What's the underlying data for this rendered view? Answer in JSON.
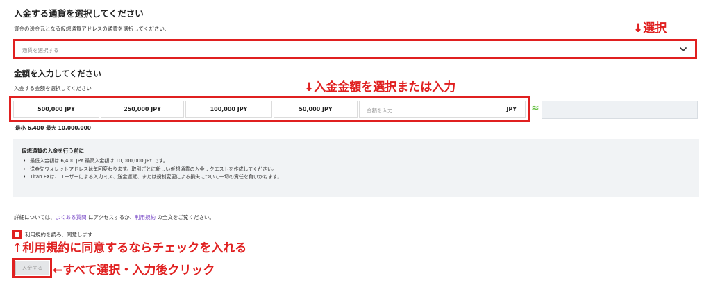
{
  "section1": {
    "title": "入金する通貨を選択してください",
    "subtitle": "資金の送金元となる仮想通貨アドレスの通貨を選択してください:",
    "select_placeholder": "通貨を選択する",
    "icon": "chevron-down-icon"
  },
  "section2": {
    "title": "金額を入力してください",
    "subtitle": "入金する金額を選択してください",
    "amounts": [
      "500,000 JPY",
      "250,000 JPY",
      "100,000 JPY",
      "50,000 JPY"
    ],
    "input_placeholder": "金額を入力",
    "input_currency": "JPY",
    "approx_symbol": "≈",
    "limits": "最小 6,400   最大 10,000,000"
  },
  "info": {
    "title": "仮想通貨の入金を行う前に",
    "items": [
      "最低入金額は 6,400 JPY   最高入金額は 10,000,000 JPY です。",
      "送金先ウォレットアドレスは毎回変わります。取引ごとに新しい仮想通貨の入金リクエストを作成してください。",
      "Titan FXは、ユーザーによる入力ミス、送金遅延、または規制変更による損失について一切の責任を負いかねます。"
    ]
  },
  "footer": {
    "prefix": "詳細については、",
    "faq_link": "よくある質問",
    "middle": " にアクセスするか、",
    "terms_link": "利用規約",
    "suffix": " の全文をご覧ください。"
  },
  "agree": {
    "label": "利用規約を読み、同意します"
  },
  "deposit_button": "入金する",
  "annotations": {
    "select": "↓選択",
    "amount": "↓入金金額を選択または入力",
    "agree": "↑利用規約に同意するならチェックを入れる",
    "submit": "←すべて選択・入力後クリック"
  },
  "colors": {
    "annotation_red": "#e02020",
    "link_purple": "#7b4cc8",
    "approx_green": "#6cc24a"
  }
}
